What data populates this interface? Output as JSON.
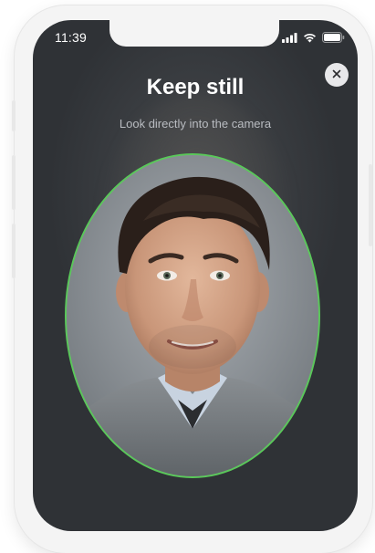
{
  "status_bar": {
    "time": "11:39",
    "icons": [
      "signal-icon",
      "wifi-icon",
      "battery-icon"
    ]
  },
  "header": {
    "title": "Keep still",
    "subtitle": "Look directly into the camera"
  },
  "close_button": {
    "icon": "close-icon",
    "glyph": "×"
  },
  "face_frame": {
    "outline_color": "#5ac85a"
  }
}
